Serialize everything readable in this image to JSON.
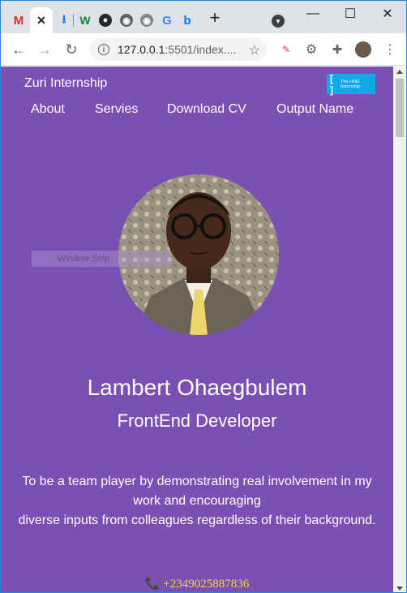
{
  "browser": {
    "url_host": "127.0.0.1",
    "url_rest": ":5501/index....",
    "colors": {
      "tabbar": "#dee1e6",
      "window_border": "#1e88e5"
    }
  },
  "site": {
    "brand": "Zuri Internship",
    "logo_text": "The HNG Internship",
    "nav": [
      "About",
      "Servies",
      "Download CV",
      "Output Name"
    ],
    "name": "Lambert Ohaegbulem",
    "role": "FrontEnd Developer",
    "bio_line1": "To be a team player by demonstrating real involvement in my",
    "bio_line2": "work and encouraging",
    "bio_line3": "diverse inputs from colleagues regardless of their background.",
    "phone": "+2349025887836",
    "watermark": "Window Snip",
    "colors": {
      "background": "#7b4fb3",
      "text": "#ffffff",
      "phone": "#f5d83a",
      "logo": "#0fa8e8"
    }
  }
}
